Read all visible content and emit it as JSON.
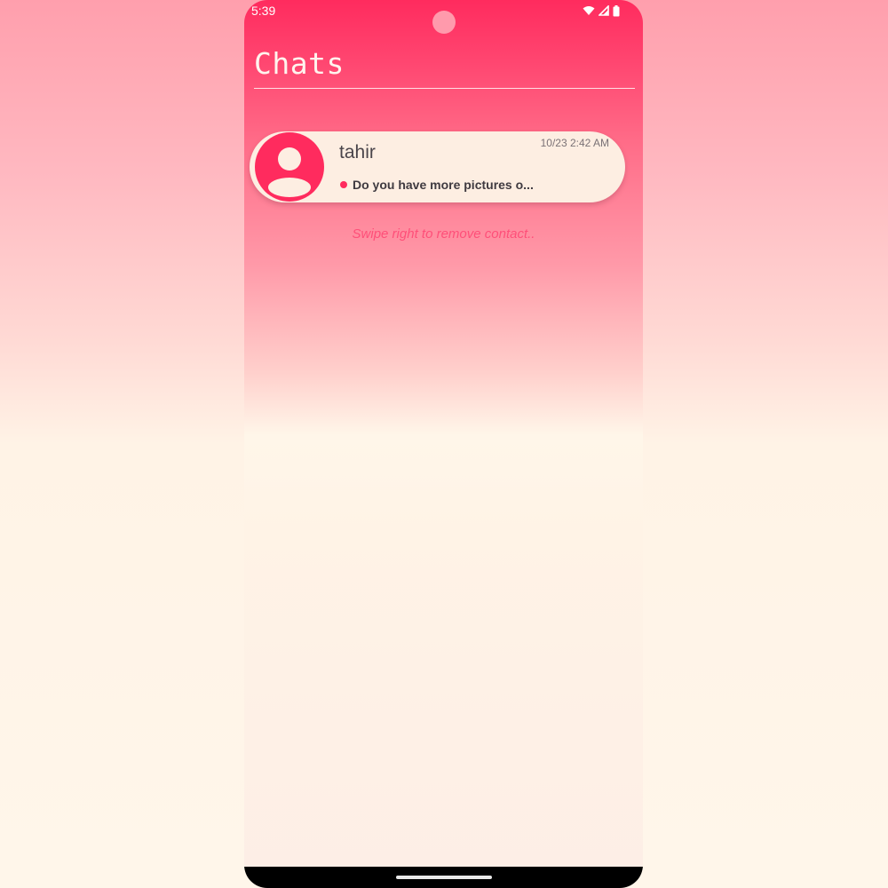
{
  "status_bar": {
    "time": "5:39",
    "icons": [
      "wifi-icon",
      "signal-icon",
      "battery-icon"
    ]
  },
  "header": {
    "title": "Chats"
  },
  "chats": [
    {
      "name": "tahir",
      "timestamp": "10/23 2:42 AM",
      "last_message": "Do you have more pictures o...",
      "unread": true,
      "avatar_icon": "person-avatar-icon"
    }
  ],
  "hint": "Swipe right to remove contact..",
  "colors": {
    "accent": "#ff2b5e",
    "card_background": "#fdeee2",
    "title_text": "#fff4ee"
  }
}
